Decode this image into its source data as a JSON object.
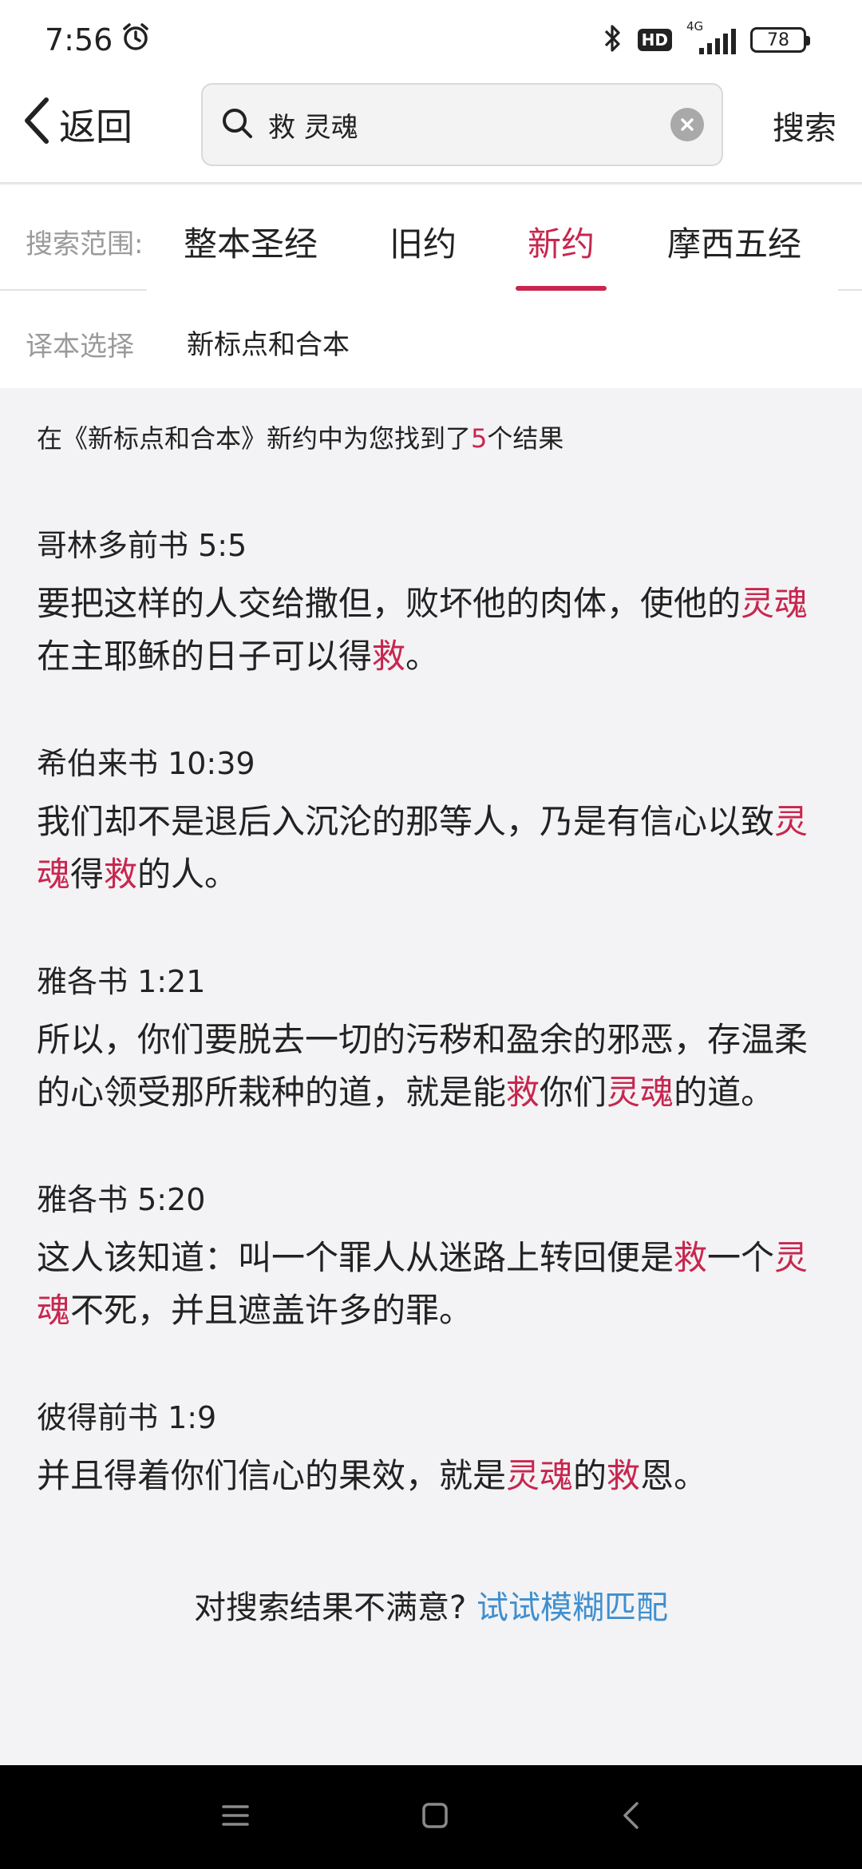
{
  "status": {
    "time": "7:56",
    "network": "4G",
    "hd": "HD",
    "battery": "78"
  },
  "header": {
    "back_label": "返回",
    "search_value": "救 灵魂",
    "search_button": "搜索"
  },
  "scope": {
    "label": "搜索范围:",
    "tabs": [
      "整本圣经",
      "旧约",
      "新约",
      "摩西五经"
    ],
    "active": "新约"
  },
  "version": {
    "label": "译本选择",
    "value": "新标点和合本"
  },
  "summary": {
    "prefix": "在《新标点和合本》新约中为您找到了",
    "count": "5",
    "suffix": "个结果"
  },
  "results": [
    {
      "ref": "哥林多前书 5:5",
      "parts": [
        {
          "t": "要把这样的人交给撒但，败坏他的肉体，使他的",
          "h": false
        },
        {
          "t": "灵魂",
          "h": true
        },
        {
          "t": "在主耶稣的日子可以得",
          "h": false
        },
        {
          "t": "救",
          "h": true
        },
        {
          "t": "。",
          "h": false
        }
      ]
    },
    {
      "ref": "希伯来书 10:39",
      "parts": [
        {
          "t": "我们却不是退后入沉沦的那等人，乃是有信心以致",
          "h": false
        },
        {
          "t": "灵魂",
          "h": true
        },
        {
          "t": "得",
          "h": false
        },
        {
          "t": "救",
          "h": true
        },
        {
          "t": "的人。",
          "h": false
        }
      ]
    },
    {
      "ref": "雅各书 1:21",
      "parts": [
        {
          "t": "所以，你们要脱去一切的污秽和盈余的邪恶，存温柔的心领受那所栽种的道，就是能",
          "h": false
        },
        {
          "t": "救",
          "h": true
        },
        {
          "t": "你们",
          "h": false
        },
        {
          "t": "灵魂",
          "h": true
        },
        {
          "t": "的道。",
          "h": false
        }
      ]
    },
    {
      "ref": "雅各书 5:20",
      "parts": [
        {
          "t": "这人该知道：叫一个罪人从迷路上转回便是",
          "h": false
        },
        {
          "t": "救",
          "h": true
        },
        {
          "t": "一个",
          "h": false
        },
        {
          "t": "灵魂",
          "h": true
        },
        {
          "t": "不死，并且遮盖许多的罪。",
          "h": false
        }
      ]
    },
    {
      "ref": "彼得前书 1:9",
      "parts": [
        {
          "t": "并且得着你们信心的果效，就是",
          "h": false
        },
        {
          "t": "灵魂",
          "h": true
        },
        {
          "t": "的",
          "h": false
        },
        {
          "t": "救",
          "h": true
        },
        {
          "t": "恩。",
          "h": false
        }
      ]
    }
  ],
  "footer": {
    "prompt": "对搜索结果不满意?",
    "link": "试试模糊匹配"
  },
  "colors": {
    "accent": "#c8264e",
    "link": "#3f8fcf"
  }
}
